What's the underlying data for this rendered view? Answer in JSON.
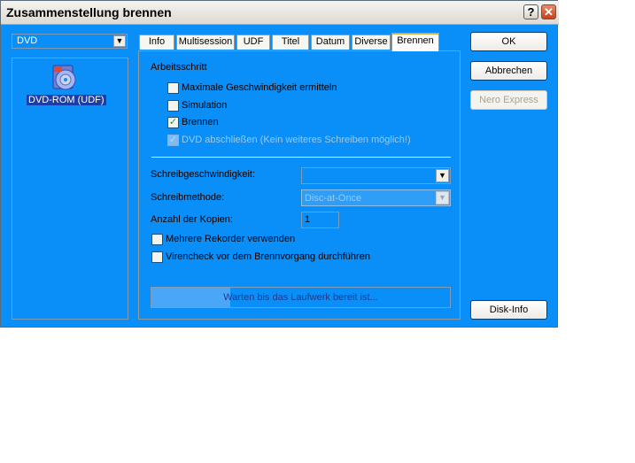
{
  "window": {
    "title": "Zusammenstellung brennen"
  },
  "titlebar": {
    "help_glyph": "?",
    "close_glyph": "✕"
  },
  "source": {
    "dropdown_value": "DVD",
    "items": [
      {
        "label": "DVD-ROM (UDF)",
        "icon": "disc-icon"
      }
    ]
  },
  "tabs": [
    {
      "label": "Info"
    },
    {
      "label": "Multisession"
    },
    {
      "label": "UDF"
    },
    {
      "label": "Titel"
    },
    {
      "label": "Datum"
    },
    {
      "label": "Diverse"
    },
    {
      "label": "Brennen",
      "active": true
    }
  ],
  "brennen": {
    "group_label": "Arbeitsschritt",
    "steps": [
      {
        "label": "Maximale Geschwindigkeit ermitteln",
        "checked": false,
        "enabled": true
      },
      {
        "label": "Simulation",
        "checked": false,
        "enabled": true
      },
      {
        "label": "Brennen",
        "checked": true,
        "enabled": true
      },
      {
        "label": "DVD abschließen (Kein weiteres Schreiben möglich!)",
        "checked": true,
        "enabled": false
      }
    ],
    "speed_label": "Schreibgeschwindigkeit:",
    "speed_value": "",
    "method_label": "Schreibmethode:",
    "method_value": "Disc-at-Once",
    "copies_label": "Anzahl der Kopien:",
    "copies_value": "1",
    "options": [
      {
        "label": "Mehrere Rekorder verwenden",
        "checked": false
      },
      {
        "label": "Virencheck vor dem Brennvorgang durchführen",
        "checked": false
      }
    ],
    "status_text": "Warten bis das Laufwerk bereit ist..."
  },
  "buttons": {
    "ok": "OK",
    "cancel": "Abbrechen",
    "nero_express": "Nero Express",
    "disk_info": "Disk-Info"
  },
  "colors": {
    "accent": "#0a8ef7",
    "selection": "#1a3da8",
    "check": "#21a121"
  }
}
